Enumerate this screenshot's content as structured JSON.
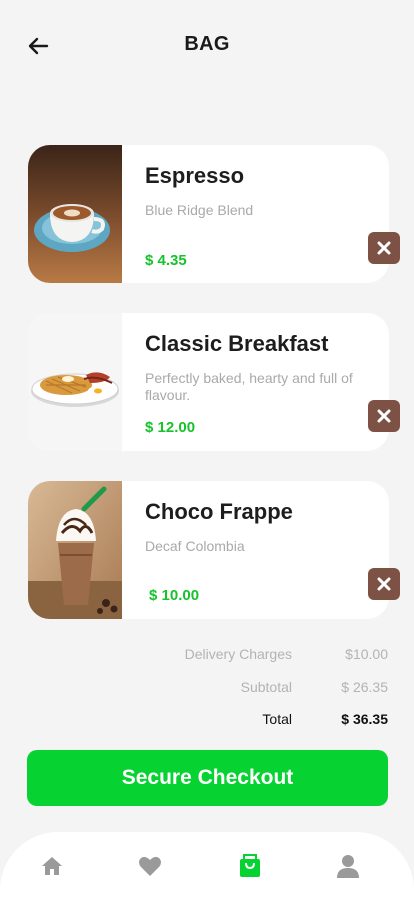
{
  "header": {
    "title": "BAG"
  },
  "items": [
    {
      "name": "Espresso",
      "description": "Blue Ridge Blend",
      "price": "$ 4.35"
    },
    {
      "name": "Classic Breakfast",
      "description": "Perfectly baked, hearty and full of flavour.",
      "price": "$ 12.00"
    },
    {
      "name": "Choco Frappe",
      "description": "Decaf Colombia",
      "price": "$ 10.00"
    }
  ],
  "summary": {
    "delivery_label": "Delivery Charges",
    "delivery_value": "$10.00",
    "subtotal_label": "Subtotal",
    "subtotal_value": "$ 26.35",
    "total_label": "Total",
    "total_value": "$ 36.35"
  },
  "checkout": {
    "label": "Secure Checkout"
  },
  "colors": {
    "accent": "#06d331",
    "price": "#18c22a",
    "remove": "#7d5244"
  },
  "nav": {
    "icons": [
      "home-icon",
      "heart-icon",
      "bag-icon",
      "profile-icon"
    ],
    "active": "bag-icon"
  }
}
